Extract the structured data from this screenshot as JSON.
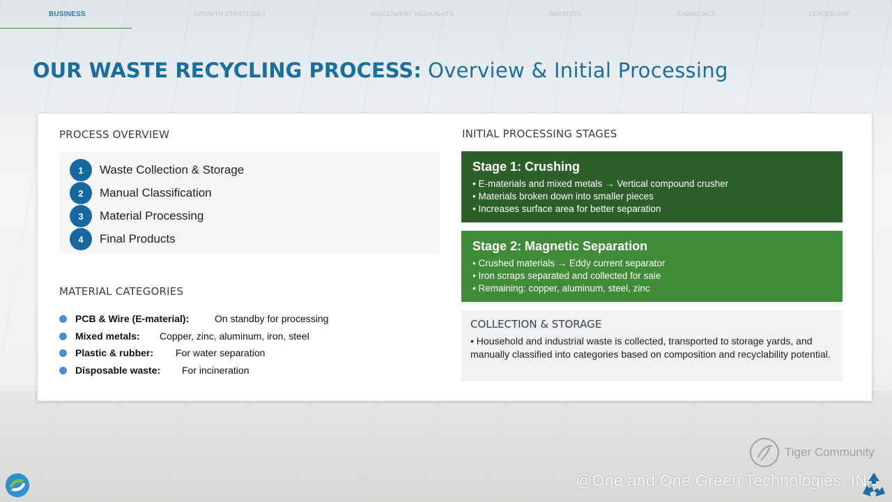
{
  "nav": {
    "items": [
      {
        "label": "BUSINESS",
        "active": true
      },
      {
        "label": "GROWTH STRATEGIES",
        "active": false
      },
      {
        "label": "INVESTMENT HIGHLIGHTS",
        "active": false
      },
      {
        "label": "INDUSTRY",
        "active": false
      },
      {
        "label": "FINANCIALS",
        "active": false
      },
      {
        "label": "LEADERSHIP",
        "active": false
      }
    ]
  },
  "title": {
    "strong": "OUR WASTE RECYCLING PROCESS:",
    "light": "Overview & Initial Processing"
  },
  "process_overview": {
    "heading": "PROCESS OVERVIEW",
    "steps": [
      {
        "num": "1",
        "label": "Waste Collection & Storage"
      },
      {
        "num": "2",
        "label": "Manual Classification"
      },
      {
        "num": "3",
        "label": "Material Processing"
      },
      {
        "num": "4",
        "label": "Final Products"
      }
    ]
  },
  "material_categories": {
    "heading": "MATERIAL CATEGORIES",
    "items": [
      {
        "label": "PCB & Wire (E-material):",
        "desc": "On standby for processing"
      },
      {
        "label": "Mixed metals:",
        "desc": "Copper, zinc, aluminum, iron, steel"
      },
      {
        "label": "Plastic & rubber:",
        "desc": "For water separation"
      },
      {
        "label": "Disposable waste:",
        "desc": "For incineration"
      }
    ]
  },
  "initial_processing": {
    "heading": "INITIAL PROCESSING STAGES",
    "stages": [
      {
        "title": "Stage 1: Crushing",
        "color": "#2d5f2b",
        "lines": [
          "• E-materials and mixed metals → Vertical compound crusher",
          "• Materials broken down into smaller pieces",
          "• Increases surface area for better separation"
        ]
      },
      {
        "title": "Stage 2: Magnetic Separation",
        "color": "#3f8b37",
        "lines": [
          "• Crushed materials → Eddy current separator",
          "• Iron scraps separated and collected for sale",
          "• Remaining: copper, aluminum, steel, zinc"
        ]
      }
    ]
  },
  "collection_storage": {
    "heading": "COLLECTION & STORAGE",
    "text": "• Household and industrial waste is collected, transported to storage yards, and manually classified into categories based on composition and recyclability potential."
  },
  "footer": {
    "watermark": "@One and One Green Technologies. INC",
    "community": "Tiger Community",
    "page_number": "5"
  },
  "colors": {
    "brand_blue": "#1a6fa0",
    "step_blue": "#1767a0",
    "bullet_blue": "#4a8fd6",
    "nav_underline": "#3a8a3a"
  }
}
